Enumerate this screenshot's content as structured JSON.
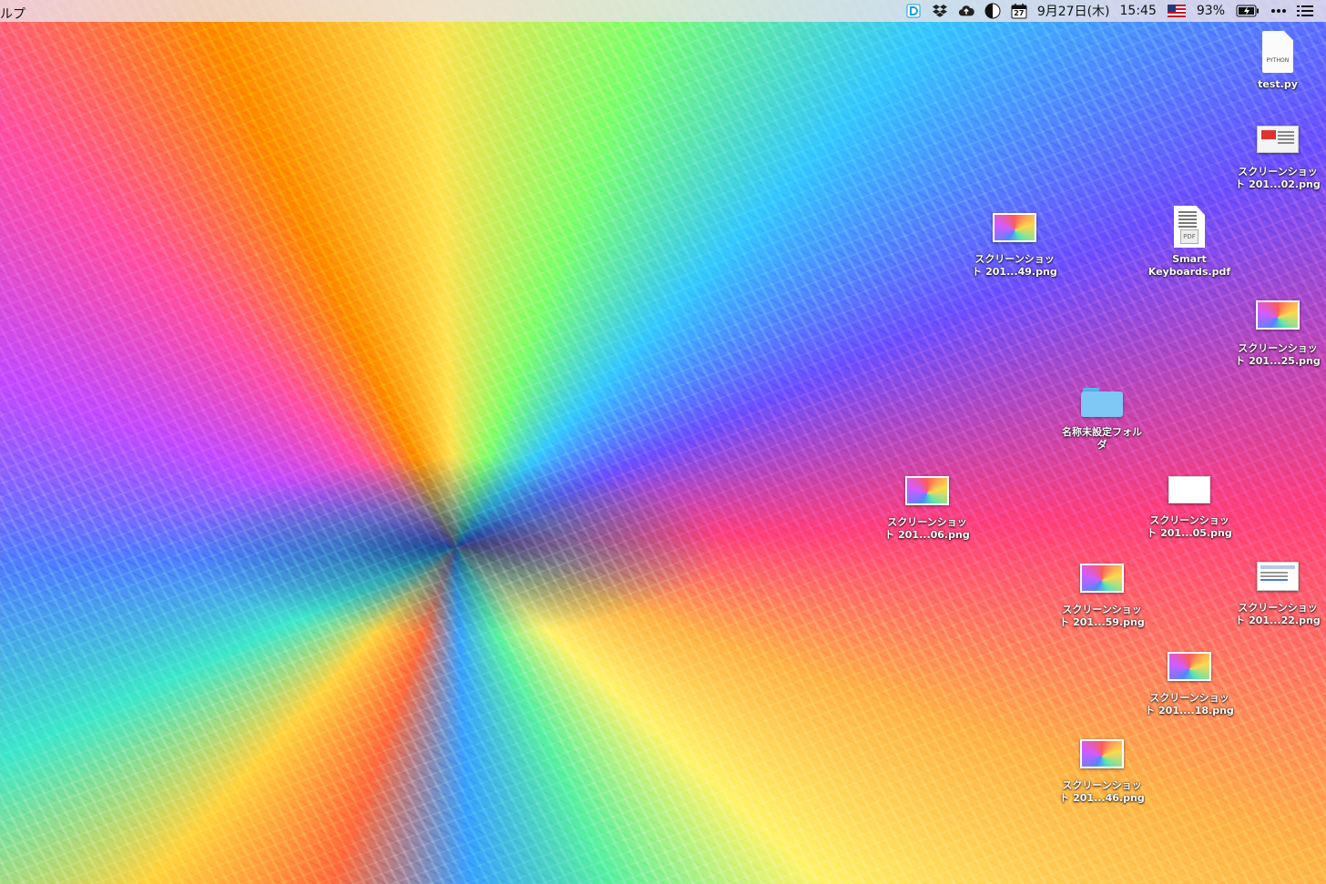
{
  "menubar": {
    "left_fragment": "ルプ",
    "date": "9月27日(木)",
    "time": "15:45",
    "battery_pct": "93%",
    "calendar_day": "27",
    "icons": [
      "dashlane-icon",
      "dropbox-icon",
      "cloud-upload-icon",
      "moon-icon",
      "calendar-icon",
      "flag-us-icon",
      "battery-icon",
      "more-icon",
      "list-icon"
    ]
  },
  "desktop": {
    "items": [
      {
        "label_line1": "test.py",
        "label_line2": "",
        "kind": "python",
        "file_type_label": "PYTHON"
      },
      {
        "label_line1": "スクリーンショッ",
        "label_line2": "ト 201...02.png",
        "kind": "screenshot-doc"
      },
      {
        "label_line1": "スクリーンショッ",
        "label_line2": "ト 201...49.png",
        "kind": "screenshot"
      },
      {
        "label_line1": "Smart",
        "label_line2": "Keyboards.pdf",
        "kind": "pdf",
        "file_type_label": "PDF"
      },
      {
        "label_line1": "スクリーンショッ",
        "label_line2": "ト 201...25.png",
        "kind": "screenshot"
      },
      {
        "label_line1": "名称未設定フォル",
        "label_line2": "ダ",
        "kind": "folder"
      },
      {
        "label_line1": "スクリーンショッ",
        "label_line2": "ト 201...06.png",
        "kind": "screenshot"
      },
      {
        "label_line1": "スクリーンショッ",
        "label_line2": "ト 201...05.png",
        "kind": "white"
      },
      {
        "label_line1": "スクリーンショッ",
        "label_line2": "ト 201...59.png",
        "kind": "screenshot"
      },
      {
        "label_line1": "スクリーンショッ",
        "label_line2": "ト 201...22.png",
        "kind": "ui"
      },
      {
        "label_line1": "スクリーンショッ",
        "label_line2": "ト 201....18.png",
        "kind": "screenshot"
      },
      {
        "label_line1": "スクリーンショッ",
        "label_line2": "ト 201...46.png",
        "kind": "screenshot"
      }
    ]
  }
}
